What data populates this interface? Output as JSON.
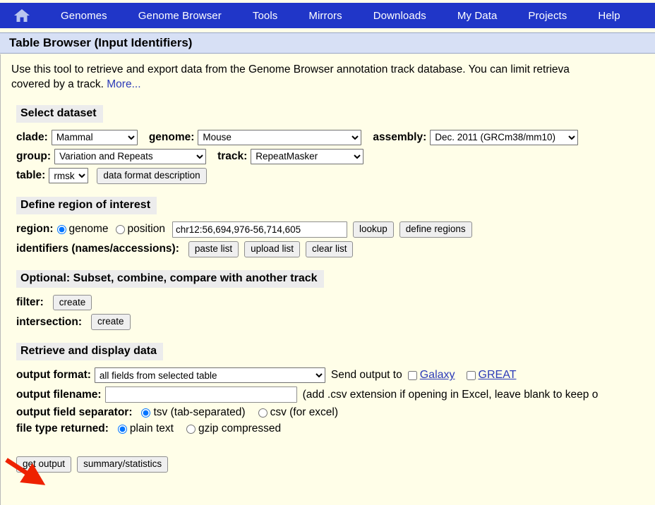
{
  "nav": {
    "home_icon": "home-icon",
    "items": [
      {
        "label": "Genomes"
      },
      {
        "label": "Genome Browser"
      },
      {
        "label": "Tools"
      },
      {
        "label": "Mirrors"
      },
      {
        "label": "Downloads"
      },
      {
        "label": "My Data"
      },
      {
        "label": "Projects"
      },
      {
        "label": "Help"
      }
    ],
    "bg_color": "#2036c8"
  },
  "page": {
    "title": "Table Browser (Input Identifiers)",
    "title_bg": "#d7e0f5",
    "body_bg": "#fffee8"
  },
  "intro": {
    "line1": "Use this tool to retrieve and export data from the Genome Browser annotation track database. You can limit retrieva",
    "line2_pre": "covered by a track. ",
    "more_label": "More..."
  },
  "select_dataset": {
    "heading": "Select dataset",
    "clade_label": "clade:",
    "clade_value": "Mammal",
    "genome_label": "genome:",
    "genome_value": "Mouse",
    "assembly_label": "assembly:",
    "assembly_value": "Dec. 2011 (GRCm38/mm10)",
    "group_label": "group:",
    "group_value": "Variation and Repeats",
    "track_label": "track:",
    "track_value": "RepeatMasker",
    "table_label": "table:",
    "table_value": "rmsk",
    "data_format_button": "data format description"
  },
  "define_region": {
    "heading": "Define region of interest",
    "region_label": "region:",
    "genome_radio_label": "genome",
    "position_radio_label": "position",
    "region_selected": "genome",
    "position_value": "chr12:56,694,976-56,714,605",
    "lookup_button": "lookup",
    "define_regions_button": "define regions",
    "identifiers_label": "identifiers (names/accessions):",
    "paste_list_button": "paste list",
    "upload_list_button": "upload list",
    "clear_list_button": "clear list"
  },
  "optional": {
    "heading": "Optional: Subset, combine, compare with another track",
    "filter_label": "filter:",
    "filter_button": "create",
    "intersection_label": "intersection:",
    "intersection_button": "create"
  },
  "retrieve": {
    "heading": "Retrieve and display data",
    "output_format_label": "output format:",
    "output_format_value": "all fields from selected table",
    "send_output_label": "Send output to",
    "galaxy_label": "Galaxy",
    "great_label": "GREAT",
    "galaxy_checked": false,
    "great_checked": false,
    "output_filename_label": "output filename:",
    "output_filename_value": "",
    "output_filename_hint": "(add .csv extension if opening in Excel, leave blank to keep o",
    "field_separator_label": "output field separator:",
    "tsv_label": "tsv (tab-separated)",
    "csv_label": "csv (for excel)",
    "separator_selected": "tsv",
    "file_type_label": "file type returned:",
    "plain_text_label": "plain text",
    "gzip_label": "gzip compressed",
    "file_type_selected": "plain text",
    "get_output_button": "get output",
    "summary_button": "summary/statistics"
  },
  "annotation": {
    "arrow_color": "#ee2200",
    "arrow_points_to": "get-output-button"
  }
}
